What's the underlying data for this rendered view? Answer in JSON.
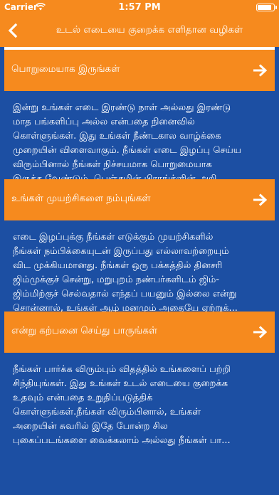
{
  "status_bar": {
    "carrier": "Carrier",
    "time": "1:57 PM"
  },
  "nav": {
    "title": "உடல் எடையை குறைக்க எளிதான வழிகள்"
  },
  "cards": [
    {
      "heading": "பொறுமையாக இருங்கள்",
      "body": "இன்று உங்கள் எடை இரண்டு நாள் அல்லது இரண்டு\nமாத பங்களிப்பு அல்ல என்பதை நினைவில்\nகொள்ளுங்கள். இது உங்கள் நீண்டகால வாழ்க்கை\nமுறையின் விளைவாகும். நீங்கள் எடை இழப்பு செய்ய\nவிரும்பினால் நீங்கள் நிச்சயமாக பொறுமையாக\nஇருக்க வேண்டும். பெஞ்சமின் பிராங்க்ளின் அறி..."
    },
    {
      "heading": "உங்கள் முயற்சிகளை நம்புங்கள்",
      "body": "எடை இழப்புக்கு நீங்கள் எடுக்கும் முயற்சிகளில்\nநீங்கள் நம்பிக்கையுடன் இருப்பது எல்லாவற்றையும்\nவிட முக்கியமானது. நீங்கள் ஒரு பக்கத்தில் தினசரி\nஜிம்முக்குச் சென்று, மறுபுறம் நண்பர்களிடம் ஜிம்-\nஜிம்மிற்குச் செல்வதால் எந்தப் பயனும் இல்லை என்று\nசொன்னால், உங்கள் ஆழ் மனமும் அதையே ஏற்றுக்..."
    },
    {
      "heading": "என்று கற்பனை செய்து பாருங்கள்",
      "body": "நீங்கள் பார்க்க விரும்பும் விதத்தில் உங்களைப் பற்றி\nசிந்தியுங்கள். இது உங்கள் உடல் எடையை குறைக்க\nஉதவும் என்பதை உறுதிப்படுத்திக்\nகொள்ளுங்கள்.நீங்கள் விரும்பினால், உங்கள்\nஅறையின் சுவரில் இதே போன்ற சில\nபுகைப்படங்களை வைக்கலாம் அல்லது நீங்கள் பா..."
    }
  ],
  "colors": {
    "accent_orange": "#f68a1e",
    "body_blue": "#1c4fa3",
    "card_border": "#ffffff"
  },
  "icons": {
    "back": "chevron-left-icon",
    "open": "arrow-right-icon"
  }
}
